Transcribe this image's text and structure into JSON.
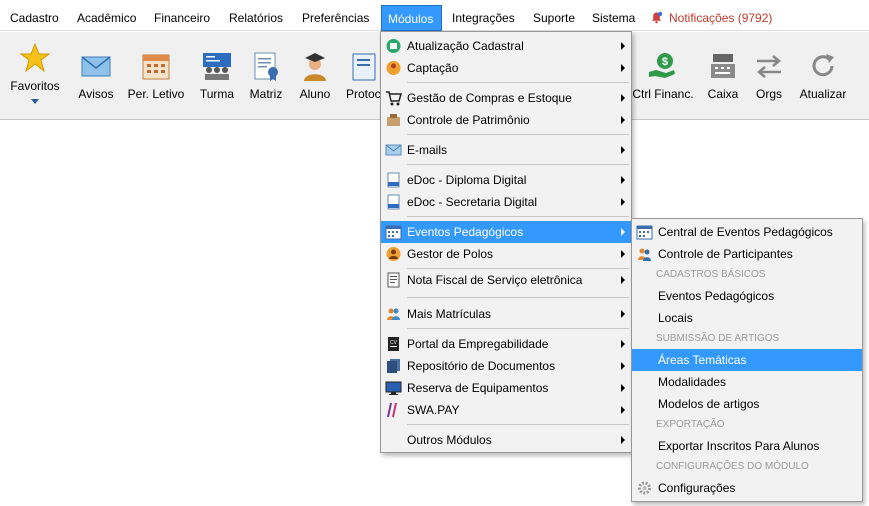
{
  "menubar": {
    "items": [
      "Cadastro",
      "Acadêmico",
      "Financeiro",
      "Relatórios",
      "Preferências",
      "Módulos",
      "Integrações",
      "Suporte",
      "Sistema"
    ],
    "notifications": "Notificações (9792)"
  },
  "toolbar": {
    "buttons": [
      "Favoritos",
      "Avisos",
      "Per. Letivo",
      "Turma",
      "Matriz",
      "Aluno",
      "Protoc",
      "Ctrl Financ.",
      "Caixa",
      "Orgs",
      "Atualizar"
    ]
  },
  "modules_menu": {
    "items": [
      "Atualização Cadastral",
      "Captação",
      "Gestão de Compras e Estoque",
      "Controle de Patrimônio",
      "E-mails",
      "eDoc - Diploma Digital",
      "eDoc - Secretaria Digital",
      "Eventos Pedagógicos",
      "Gestor de Polos",
      "Nota Fiscal de Serviço eletrônica",
      "Mais Matrículas",
      "Portal da Empregabilidade",
      "Repositório de Documentos",
      "Reserva de Equipamentos",
      "SWA.PAY",
      "Outros Módulos"
    ]
  },
  "events_submenu": {
    "items": [
      "Central de Eventos Pedagógicos",
      "Controle de Participantes",
      "Eventos Pedagógicos",
      "Locais",
      "Áreas Temáticas",
      "Modalidades",
      "Modelos de artigos",
      "Exportar Inscritos Para Alunos",
      "Configurações"
    ],
    "sections": [
      "CADASTROS BÁSICOS",
      "SUBMISSÃO DE ARTIGOS",
      "EXPORTAÇÃO",
      "CONFIGURAÇÕES DO MÓDULO"
    ]
  },
  "colors": {
    "highlight": "#3399ff",
    "notification": "#c0392b",
    "menu_bg": "#f2f2f2",
    "toolbar_bg": "#f0f0f0"
  }
}
